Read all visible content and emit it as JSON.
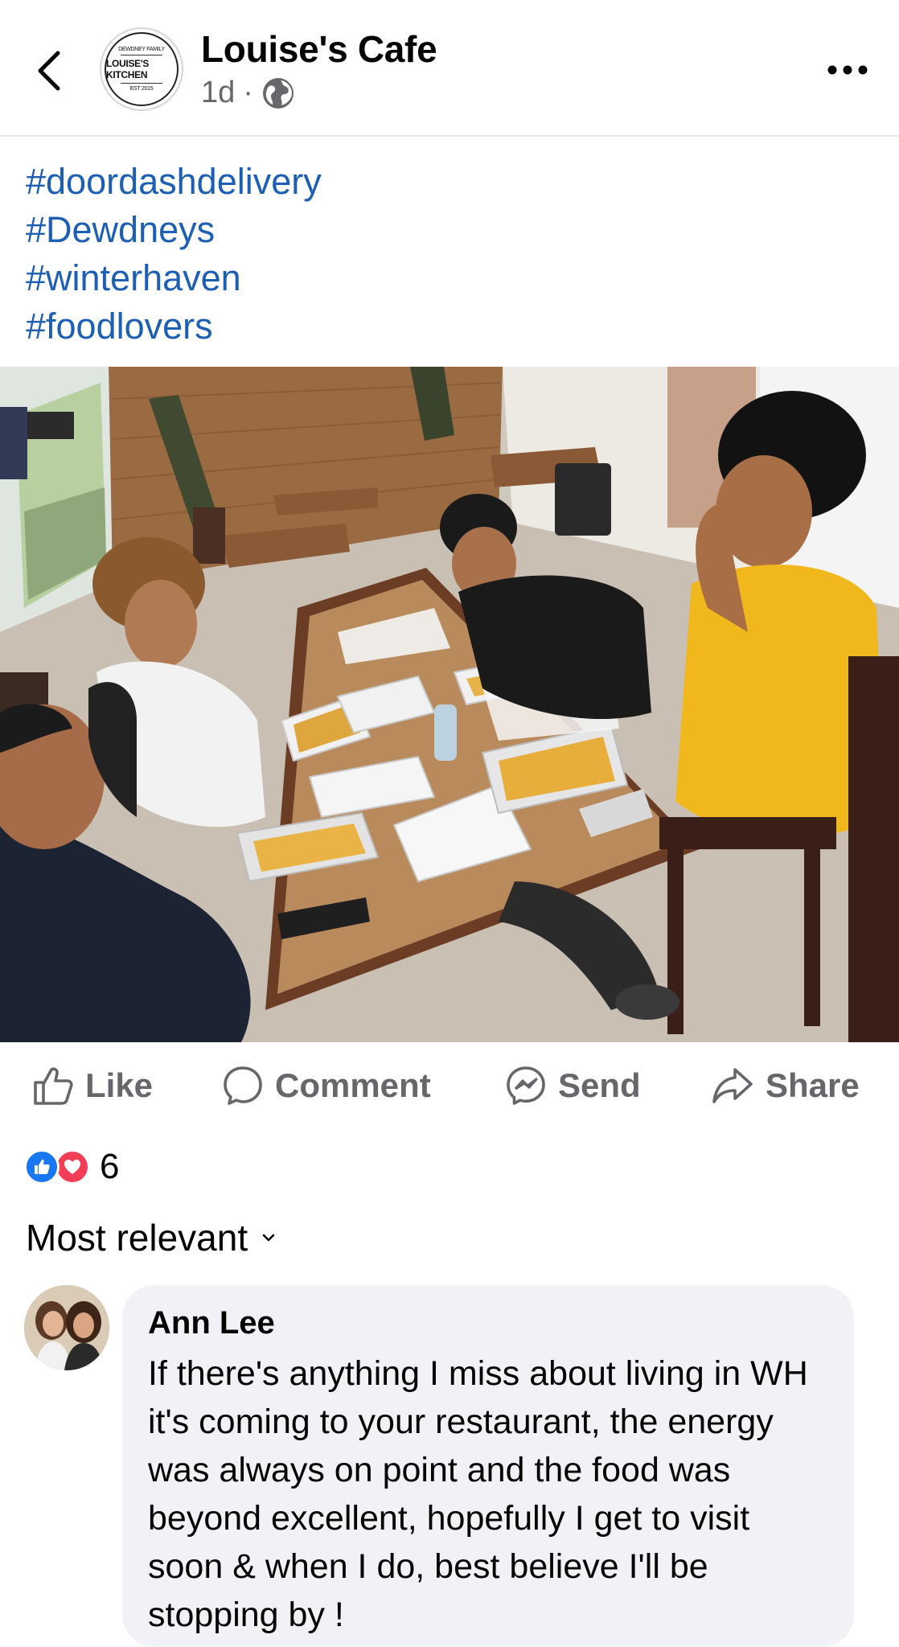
{
  "header": {
    "page_name": "Louise's Cafe",
    "time_ago": "1d",
    "separator": "·",
    "privacy_icon": "globe-icon",
    "logo_text": "LOUISE'S KITCHEN",
    "logo_top_text": "DEWDNEY FAMILY",
    "logo_bottom_text": "EST 2015"
  },
  "post": {
    "hashtags": [
      "#doordashdelivery",
      "#Dewdneys",
      "#winterhaven",
      "#foodlovers"
    ],
    "photo_alt": "Four teens laughing at a restaurant table with takeout containers of food"
  },
  "actions": {
    "like": "Like",
    "comment": "Comment",
    "send": "Send",
    "share": "Share"
  },
  "reactions": {
    "count": "6",
    "types": [
      "like-icon",
      "love-icon"
    ],
    "colors": {
      "like": "#1877f2",
      "love": "#f33e58"
    }
  },
  "comments_sort": {
    "label": "Most relevant"
  },
  "comments": [
    {
      "author": "Ann Lee",
      "text": "If there's anything I miss about living in WH it's coming to your restaurant,  the energy was always on point and the food was beyond excellent, hopefully I get to visit soon & when I do, best believe I'll be stopping by !"
    }
  ],
  "colors": {
    "link": "#1d5fb4",
    "muted": "#65676b",
    "bubble": "#f0f2f5"
  }
}
